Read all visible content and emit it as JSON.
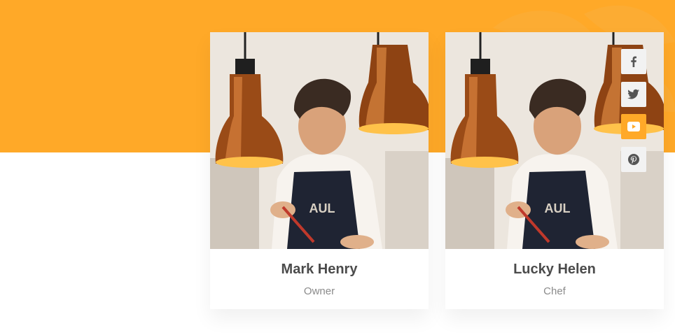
{
  "team": [
    {
      "name": "Mark Henry",
      "role": "Owner"
    },
    {
      "name": "Lucky Helen",
      "role": "Chef",
      "social_links": [
        {
          "icon": "facebook-icon",
          "active": false
        },
        {
          "icon": "twitter-icon",
          "active": false
        },
        {
          "icon": "youtube-icon",
          "active": true
        },
        {
          "icon": "pinterest-icon",
          "active": false
        }
      ]
    }
  ],
  "colors": {
    "accent": "#FFA928",
    "name_text": "#4b4b4b",
    "role_text": "#8b8b8b",
    "icon_bg": "#f2f2f2",
    "icon_fg": "#555555"
  }
}
